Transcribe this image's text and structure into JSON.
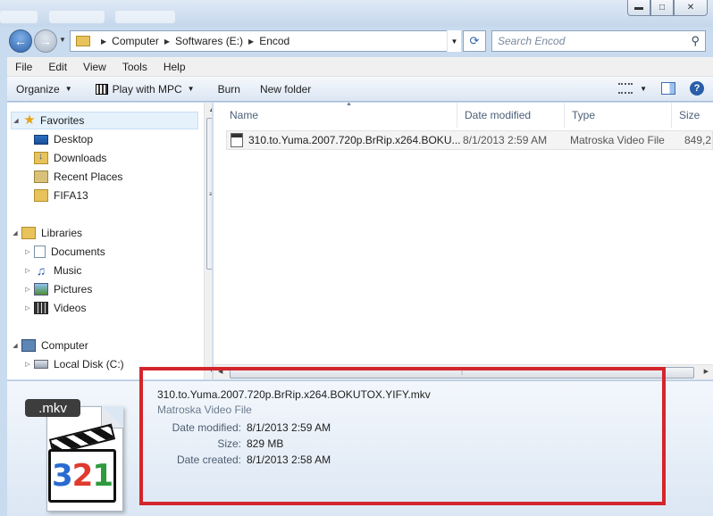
{
  "window": {
    "minimize_icon": "minimize-icon",
    "maximize_icon": "maximize-icon",
    "close_icon": "close-icon"
  },
  "address_bar": {
    "crumbs": [
      "Computer",
      "Softwares (E:)",
      "Encod"
    ],
    "search_placeholder": "Search Encod"
  },
  "menu": [
    "File",
    "Edit",
    "View",
    "Tools",
    "Help"
  ],
  "toolbar": {
    "organize": "Organize",
    "play": "Play with MPC",
    "burn": "Burn",
    "new_folder": "New folder"
  },
  "nav": {
    "favorites": "Favorites",
    "desktop": "Desktop",
    "downloads": "Downloads",
    "recent": "Recent Places",
    "fifa": "FIFA13",
    "libraries": "Libraries",
    "documents": "Documents",
    "music": "Music",
    "pictures": "Pictures",
    "videos": "Videos",
    "computer": "Computer",
    "local_disk": "Local Disk (C:)"
  },
  "columns": {
    "name": "Name",
    "date": "Date modified",
    "type": "Type",
    "size": "Size"
  },
  "files": [
    {
      "name": "310.to.Yuma.2007.720p.BrRip.x264.BOKU...",
      "date": "8/1/2013 2:59 AM",
      "type": "Matroska Video File",
      "size": "849,2"
    }
  ],
  "details": {
    "extension": ".mkv",
    "filename": "310.to.Yuma.2007.720p.BrRip.x264.BOKUTOX.YIFY.mkv",
    "filetype": "Matroska Video File",
    "date_modified_label": "Date modified:",
    "date_modified": "8/1/2013 2:59 AM",
    "size_label": "Size:",
    "size": "829 MB",
    "date_created_label": "Date created:",
    "date_created": "8/1/2013 2:58 AM",
    "icon_digits": [
      "3",
      "2",
      "1"
    ]
  },
  "colors": {
    "highlight": "#d4252c",
    "accent": "#2e62a8"
  }
}
